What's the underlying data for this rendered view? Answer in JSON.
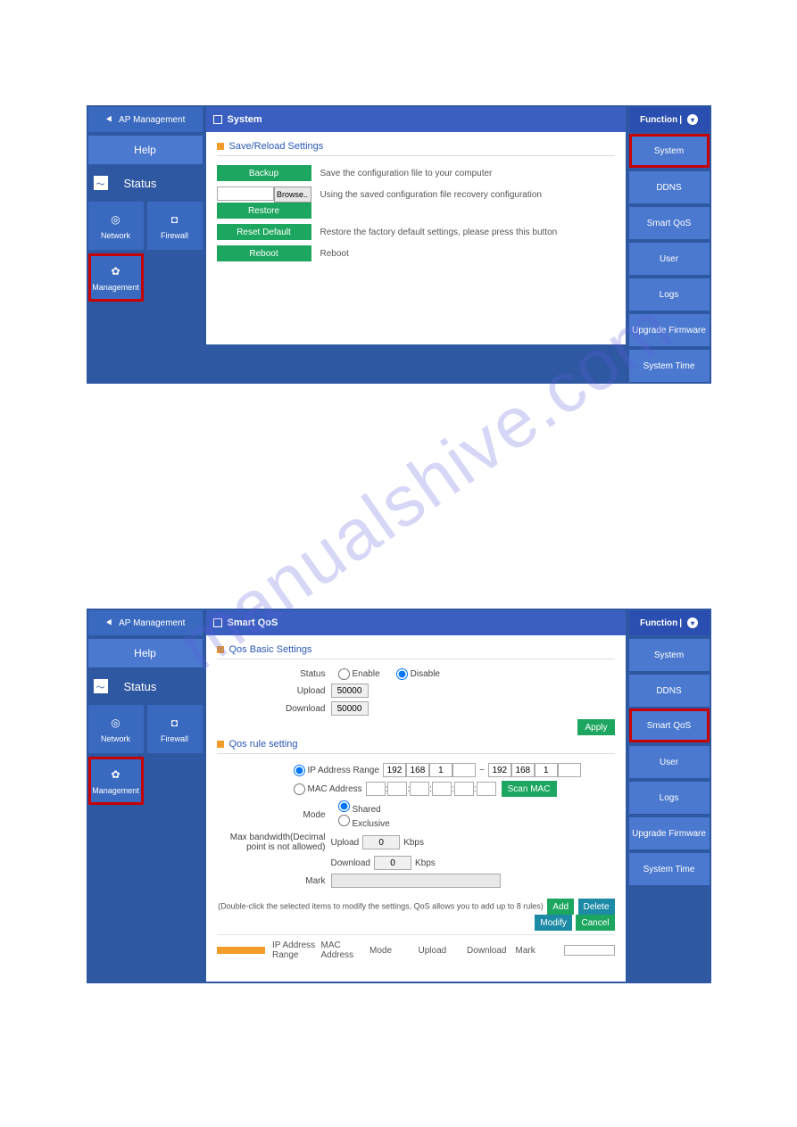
{
  "watermark": "manualshive.com",
  "screens": [
    {
      "left": {
        "ap": "AP Management",
        "help": "Help",
        "status": "Status",
        "tiles": [
          {
            "label": "Network",
            "icon": "◎",
            "name": "network-tile"
          },
          {
            "label": "Firewall",
            "icon": "◘",
            "name": "firewall-tile"
          }
        ],
        "mgmt": {
          "label": "Management",
          "icon": "✿",
          "highlight": true
        }
      },
      "header": "System",
      "section": "Save/Reload Settings",
      "rows": [
        {
          "btn": "Backup",
          "desc": "Save the configuration file to your computer",
          "type": "btn"
        },
        {
          "btn": "Browse..",
          "desc": "",
          "type": "file"
        },
        {
          "btn": "Restore",
          "desc": "Using the saved configuration file recovery configuration",
          "type": "btn"
        },
        {
          "btn": "Reset Default",
          "desc": "Restore the factory default settings, please press this button",
          "type": "btn"
        },
        {
          "btn": "Reboot",
          "desc": "Reboot",
          "type": "btn"
        }
      ],
      "right": {
        "header": "Function",
        "items": [
          {
            "label": "System",
            "highlight": true,
            "name": "func-system"
          },
          {
            "label": "DDNS",
            "name": "func-ddns"
          },
          {
            "label": "Smart QoS",
            "name": "func-smartqos"
          },
          {
            "label": "User",
            "name": "func-user"
          },
          {
            "label": "Logs",
            "name": "func-logs"
          },
          {
            "label": "Upgrade Firmware",
            "name": "func-upgrade"
          },
          {
            "label": "System Time",
            "name": "func-systime"
          }
        ]
      }
    },
    {
      "left": {
        "ap": "AP Management",
        "help": "Help",
        "status": "Status",
        "tiles": [
          {
            "label": "Network",
            "icon": "◎",
            "name": "network-tile"
          },
          {
            "label": "Firewall",
            "icon": "◘",
            "name": "firewall-tile"
          }
        ],
        "mgmt": {
          "label": "Management",
          "icon": "✿",
          "highlight": true
        }
      },
      "header": "Smart QoS",
      "qos_basic": {
        "title": "Qos Basic Settings",
        "status_label": "Status",
        "enable": "Enable",
        "disable": "Disable",
        "upload_label": "Upload",
        "upload_val": "50000",
        "download_label": "Download",
        "download_val": "50000",
        "apply": "Apply"
      },
      "qos_rule": {
        "title": "Qos rule setting",
        "ip_label": "IP Address Range",
        "ip_from": [
          "192",
          "168",
          "1",
          ""
        ],
        "ip_to": [
          "192",
          "168",
          "1",
          ""
        ],
        "mac_label": "MAC Address",
        "mac": [
          "",
          "",
          "",
          "",
          "",
          ""
        ],
        "scan": "Scan MAC",
        "mode_label": "Mode",
        "shared": "Shared",
        "exclusive": "Exclusive",
        "bw_label": "Max bandwidth(Decimal point is not allowed)",
        "up": "Upload",
        "up_val": "0",
        "kbps": "Kbps",
        "dn": "Download",
        "dn_val": "0",
        "mark_label": "Mark",
        "mark_val": "",
        "hint": "(Double-click the selected items to modify the settings, QoS allows you to add up to 8 rules)",
        "buttons": {
          "add": "Add",
          "delete": "Delete",
          "modify": "Modify",
          "cancel": "Cancel"
        },
        "cols": [
          "IP Address Range",
          "MAC Address",
          "Mode",
          "Upload",
          "Download",
          "Mark"
        ]
      },
      "right": {
        "header": "Function",
        "items": [
          {
            "label": "System",
            "name": "func-system"
          },
          {
            "label": "DDNS",
            "name": "func-ddns"
          },
          {
            "label": "Smart QoS",
            "highlight": true,
            "name": "func-smartqos"
          },
          {
            "label": "User",
            "name": "func-user"
          },
          {
            "label": "Logs",
            "name": "func-logs"
          },
          {
            "label": "Upgrade Firmware",
            "name": "func-upgrade"
          },
          {
            "label": "System Time",
            "name": "func-systime"
          }
        ]
      }
    }
  ]
}
